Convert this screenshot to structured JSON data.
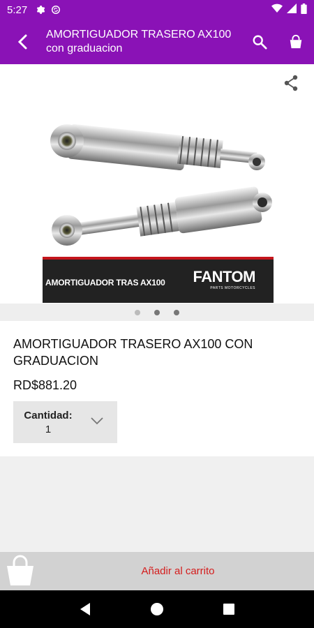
{
  "status_bar": {
    "time": "5:27",
    "icons": [
      "settings-icon",
      "sync-icon",
      "wifi-icon",
      "signal-icon",
      "battery-icon"
    ]
  },
  "app_bar": {
    "title_line1": "AMORTIGUADOR TRASERO AX100",
    "title_line2": "con graduacion",
    "background": "#8a12b6",
    "icons": [
      "back-arrow-icon",
      "search-icon",
      "shopping-bag-icon"
    ]
  },
  "gallery": {
    "share_icon": "share-icon",
    "banner_text": "AMORTIGUADOR TRAS AX100",
    "banner_brand": "FANTOM",
    "banner_sub": "PARTS MOTORCYCLES",
    "dots": [
      {
        "active": false
      },
      {
        "active": true
      },
      {
        "active": true
      }
    ]
  },
  "product": {
    "title": "AMORTIGUADOR TRASERO AX100 CON GRADUACION",
    "price": "RD$881.20",
    "quantity_label": "Cantidad:",
    "quantity_value": "1"
  },
  "bottom_bar": {
    "add_to_cart": "Añadir al carrito",
    "accent": "#d41c1c"
  },
  "nav_bar": {
    "icons": [
      "back-triangle-icon",
      "home-circle-icon",
      "recents-square-icon"
    ]
  }
}
